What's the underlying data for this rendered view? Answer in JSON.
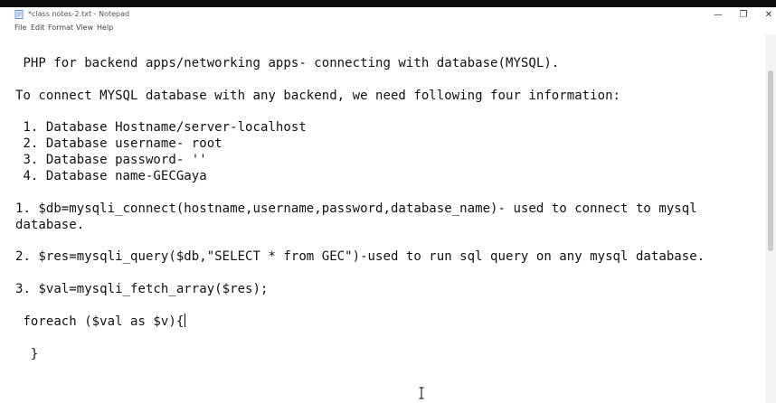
{
  "window": {
    "title": "*class notes-2.txt - Notepad",
    "controls": {
      "minimize": "—",
      "maximize": "❐",
      "close": "✕"
    }
  },
  "menu": [
    "File",
    "Edit",
    "Format",
    "View",
    "Help"
  ],
  "editor": {
    "lines": [
      " PHP for backend apps/networking apps- connecting with database(MYSQL).",
      "To connect MYSQL database with any backend, we need following four information:",
      " 1. Database Hostname/server-localhost",
      " 2. Database username- root",
      " 3. Database password- ''",
      " 4. Database name-GECGaya",
      "1. $db=mysqli_connect(hostname,username,password,database_name)- used to connect to mysql",
      "database.",
      "2. $res=mysqli_query($db,\"SELECT * from GEC\")-used to run sql query on any mysql database.",
      "3. $val=mysqli_fetch_array($res);",
      " foreach ($val as $v){",
      "  }"
    ]
  },
  "icons": {
    "app": "notepad-icon",
    "pointer": "text-cursor-icon"
  }
}
